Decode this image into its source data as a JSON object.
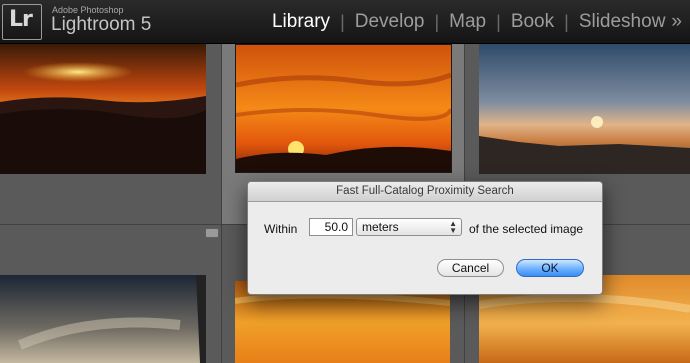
{
  "app": {
    "badge": "Lr",
    "vendor": "Adobe Photoshop",
    "product": "Lightroom 5"
  },
  "modules": [
    {
      "label": "Library",
      "active": true
    },
    {
      "label": "Develop",
      "active": false
    },
    {
      "label": "Map",
      "active": false
    },
    {
      "label": "Book",
      "active": false
    },
    {
      "label": "Slideshow",
      "active": false
    }
  ],
  "module_separator": "|",
  "more_modules_icon": "»",
  "dialog": {
    "title": "Fast Full-Catalog Proximity Search",
    "within_label": "Within",
    "distance_value": "50.0",
    "unit_selected": "meters",
    "suffix_label": "of the selected image",
    "cancel_label": "Cancel",
    "ok_label": "OK"
  },
  "colors": {
    "accent_ok_button": "#5aa6ff",
    "selected_cell": "#7a7a7a"
  }
}
